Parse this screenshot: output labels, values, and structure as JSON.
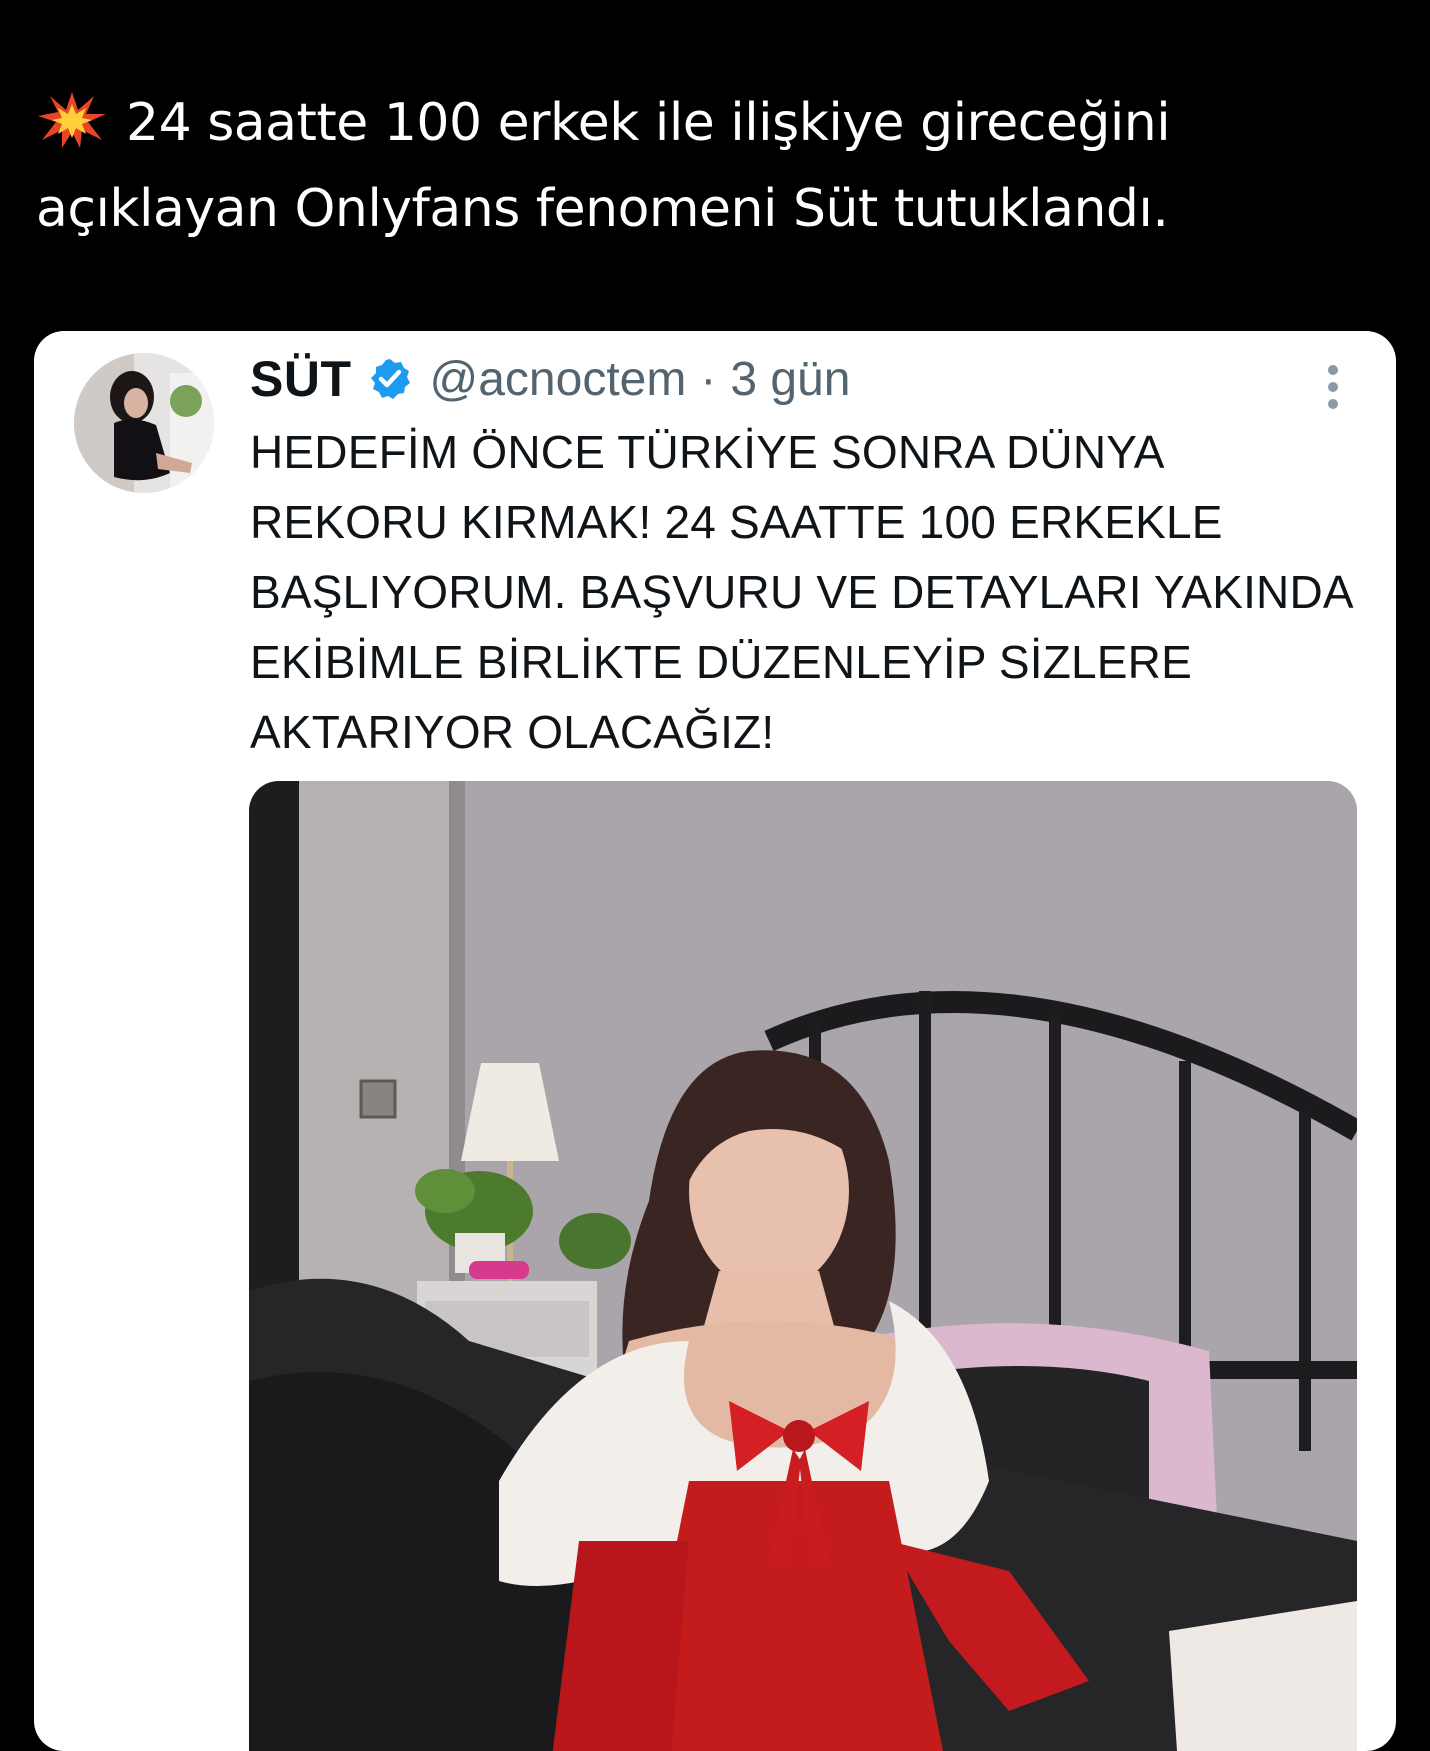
{
  "post": {
    "headline": "24 saatte 100 erkek ile ilişkiye gireceğini açıklayan Onlyfans fenomeni Süt tutuklandı.",
    "headline_icon": "collision-icon"
  },
  "tweet": {
    "display_name": "SÜT",
    "verified_icon": "verified-badge-icon",
    "handle": "@acnoctem",
    "separator": "·",
    "time": "3 gün",
    "text": "HEDEFİM ÖNCE TÜRKİYE SONRA DÜNYA REKORU KIRMAK! 24 SAATTE 100 ERKEKLE BAŞLIYORUM. BAŞVURU VE DETAYLARI YAKINDA EKİBİMLE BİRLİKTE DÜZENLEYİP SİZLERE AKTARIYOR OLACAĞIZ!",
    "more_icon": "more-options-icon"
  },
  "colors": {
    "background": "#000000",
    "card": "#ffffff",
    "verified": "#1d9bf0",
    "secondary_text": "#536471"
  }
}
